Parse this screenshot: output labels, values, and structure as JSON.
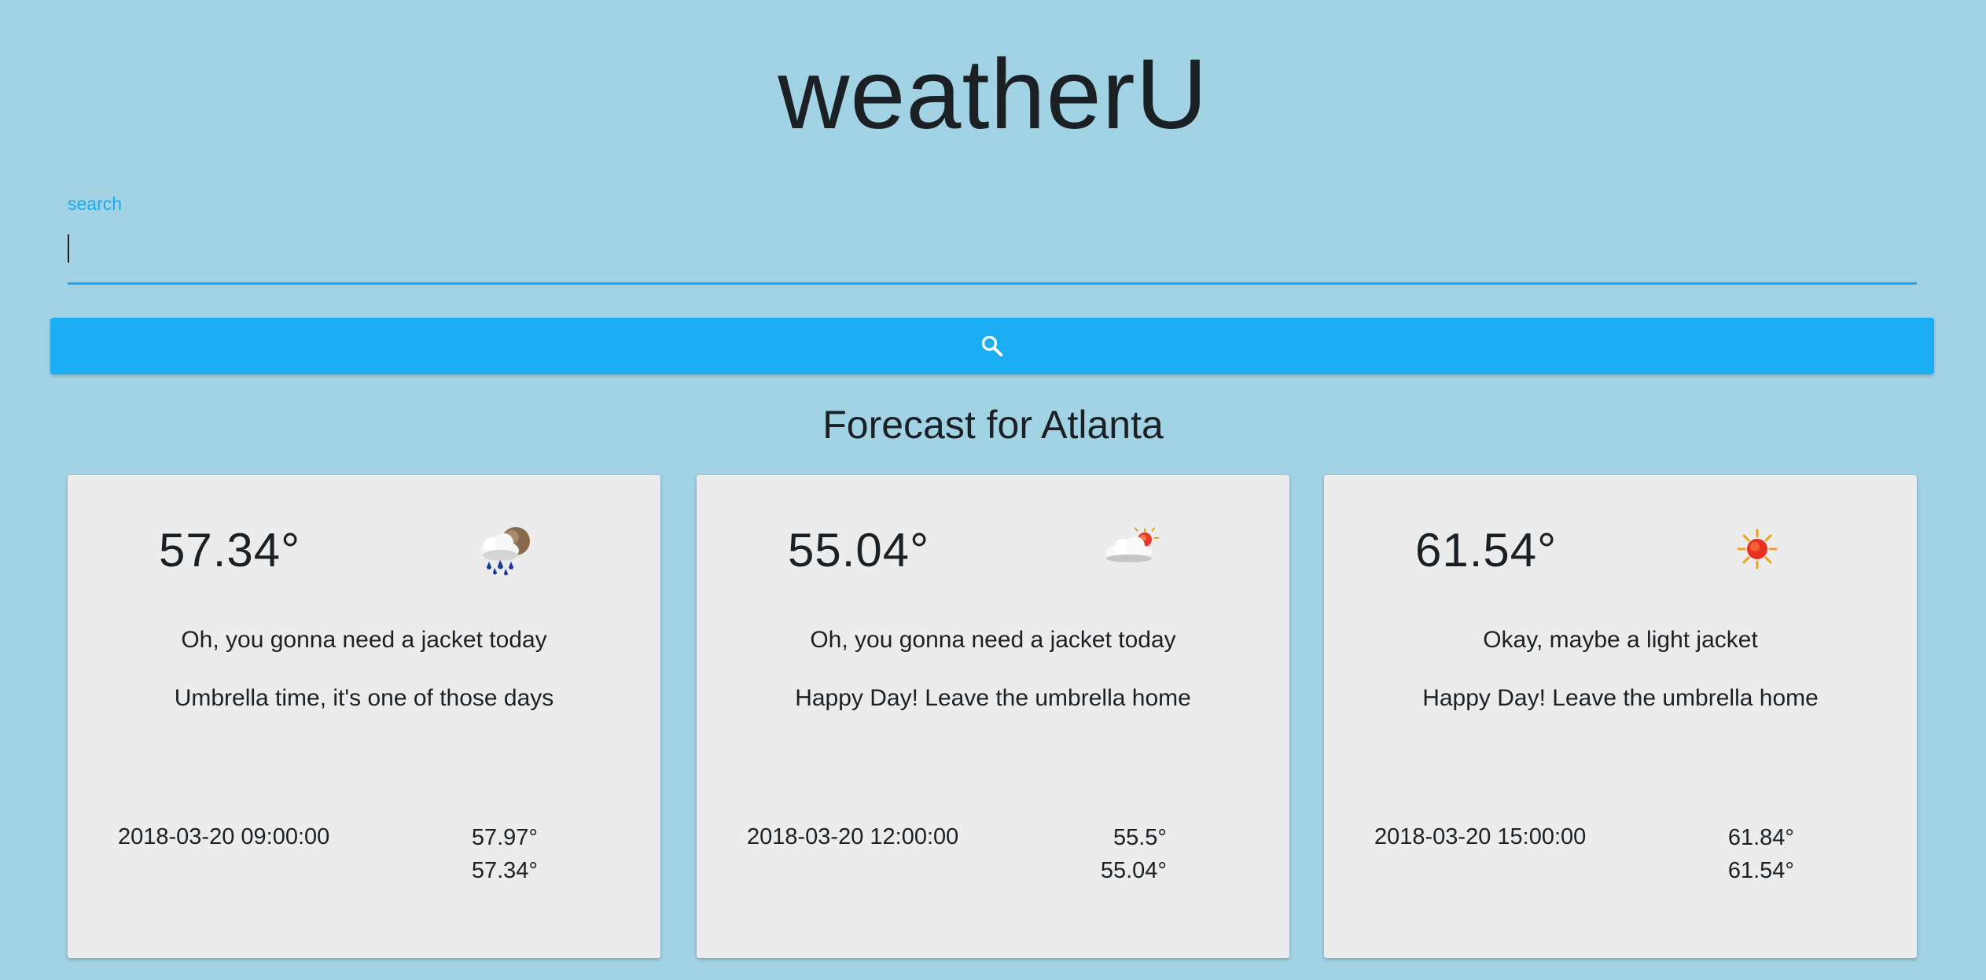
{
  "app": {
    "title": "weatherU"
  },
  "search": {
    "label": "search",
    "value": "",
    "button_icon": "search-icon"
  },
  "forecast": {
    "heading": "Forecast for Atlanta",
    "cards": [
      {
        "temp": "57.34°",
        "icon": "rain-cloud-icon",
        "message_jacket": "Oh, you gonna need a jacket today",
        "message_umbrella": "Umbrella time, it's one of those days",
        "datetime": "2018-03-20 09:00:00",
        "temp_max": "57.97°",
        "temp_min": "57.34°"
      },
      {
        "temp": "55.04°",
        "icon": "partly-cloudy-icon",
        "message_jacket": "Oh, you gonna need a jacket today",
        "message_umbrella": "Happy Day! Leave the umbrella home",
        "datetime": "2018-03-20 12:00:00",
        "temp_max": "55.5°",
        "temp_min": "55.04°"
      },
      {
        "temp": "61.54°",
        "icon": "sun-icon",
        "message_jacket": "Okay, maybe a light jacket",
        "message_umbrella": "Happy Day! Leave the umbrella home",
        "datetime": "2018-03-20 15:00:00",
        "temp_max": "61.84°",
        "temp_min": "61.54°"
      }
    ]
  },
  "colors": {
    "background": "#a2d3e4",
    "accent": "#1aadf2",
    "card": "#ececec"
  }
}
